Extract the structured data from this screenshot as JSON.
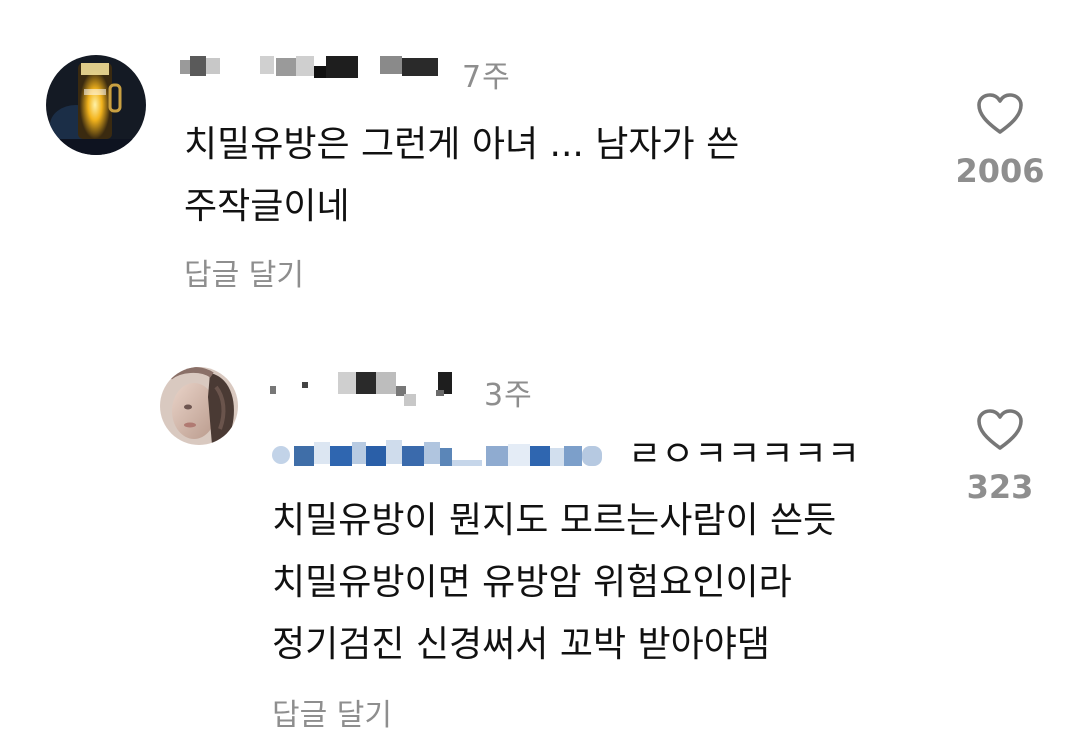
{
  "comments": [
    {
      "time": "7주",
      "text_lines": [
        "치밀유방은 그런게 아녀 ... 남자가 쓴",
        "주작글이네"
      ],
      "reply_label": "답글 달기",
      "like_count": "2006",
      "username_redacted": true,
      "avatar": "beer-glass-photo"
    },
    {
      "time": "3주",
      "mention_redacted": true,
      "text_lines": [
        "ㄹㅇㅋㅋㅋㅋㅋ",
        "치밀유방이 뭔지도 모르는사람이 쓴듯",
        "치밀유방이면 유방암 위험요인이라",
        "정기검진 신경써서 꼬박 받아야댐"
      ],
      "reply_label": "답글 달기",
      "like_count": "323",
      "username_redacted": true,
      "avatar": "portrait-photo"
    }
  ],
  "icons": {
    "like": "heart-outline-icon"
  },
  "colors": {
    "text": "#111111",
    "muted": "#8e8e8e",
    "mention": "#5b86b8",
    "background": "#ffffff"
  }
}
